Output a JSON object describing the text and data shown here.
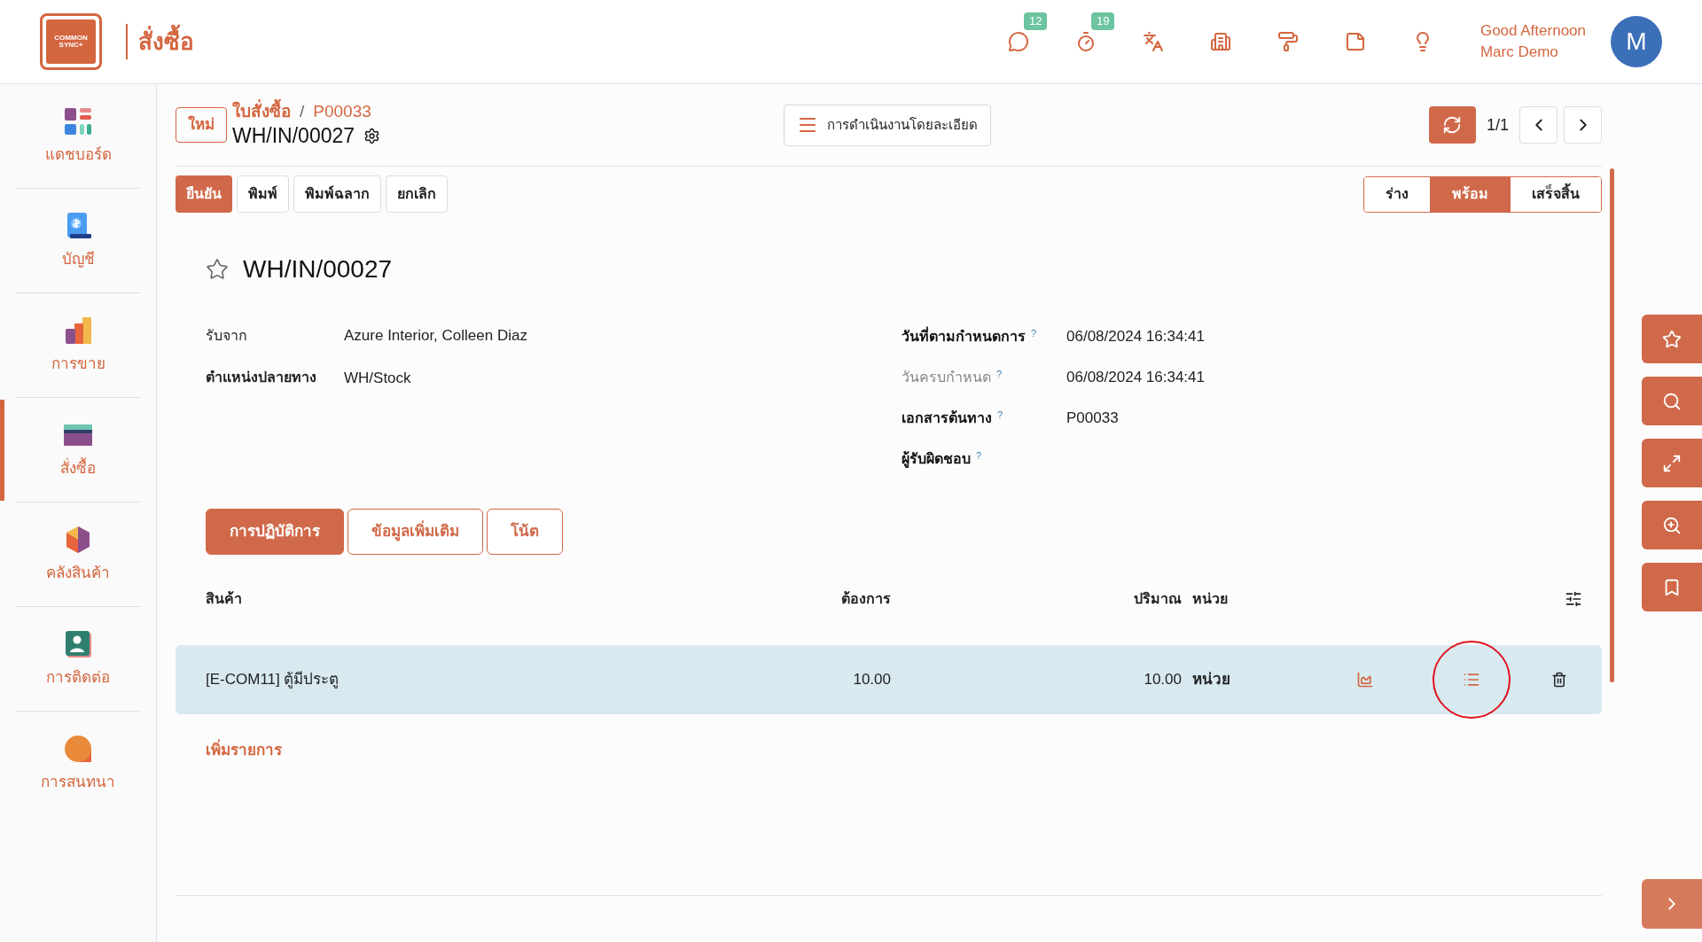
{
  "logo": {
    "lines": [
      "COMMON",
      "SYNC+"
    ]
  },
  "app": {
    "title": "สั่งซื้อ"
  },
  "topbar": {
    "icons": [
      {
        "kind": "chat",
        "badge": "12"
      },
      {
        "kind": "timer",
        "badge": "19"
      },
      {
        "kind": "translate"
      },
      {
        "kind": "company"
      },
      {
        "kind": "paint"
      },
      {
        "kind": "note"
      },
      {
        "kind": "bulb"
      }
    ],
    "greeting": "Good Afternoon",
    "user": "Marc Demo",
    "avatar": "M"
  },
  "sidebar": {
    "items": [
      {
        "kind": "dashboard",
        "label": "แดชบอร์ด",
        "selected": false
      },
      {
        "kind": "accounting",
        "label": "บัญชี",
        "selected": false
      },
      {
        "kind": "sales",
        "label": "การขาย",
        "selected": false
      },
      {
        "kind": "purchase",
        "label": "สั่งซื้อ",
        "selected": true
      },
      {
        "kind": "inventory",
        "label": "คลังสินค้า",
        "selected": false
      },
      {
        "kind": "contacts",
        "label": "การติดต่อ",
        "selected": false
      },
      {
        "kind": "discuss",
        "label": "การสนทนา",
        "selected": false
      }
    ]
  },
  "breadcrumb": {
    "new_button": "ใหม่",
    "parent": "ใบสั่งซื้อ",
    "separator": "/",
    "source": "P00033",
    "record": "WH/IN/00027"
  },
  "actions_menu": "การดำเนินงานโดยละเอียด",
  "pager": "1/1",
  "buttons": [
    {
      "label": "ยืนยัน",
      "primary": true
    },
    {
      "label": "พิมพ์",
      "primary": false
    },
    {
      "label": "พิมพ์ฉลาก",
      "primary": false
    },
    {
      "label": "ยกเลิก",
      "primary": false
    }
  ],
  "status": [
    {
      "label": "ร่าง",
      "selected": false
    },
    {
      "label": "พร้อม",
      "selected": true
    },
    {
      "label": "เสร็จสิ้น",
      "selected": false
    }
  ],
  "record": {
    "title": "WH/IN/00027",
    "starred": false
  },
  "fields_left": [
    {
      "label": "รับจาก",
      "value": "Azure Interior, Colleen Diaz",
      "bold": false
    },
    {
      "label": "ตำแหน่งปลายทาง",
      "value": "WH/Stock",
      "bold": true
    }
  ],
  "fields_right": [
    {
      "label": "วันที่ตามกำหนดการ",
      "help": "?",
      "value": "06/08/2024 16:34:41",
      "muted": false
    },
    {
      "label": "วันครบกำหนด",
      "help": "?",
      "value": "06/08/2024 16:34:41",
      "muted": true
    },
    {
      "label": "เอกสารต้นทาง",
      "help": "?",
      "value": "P00033",
      "muted": false
    },
    {
      "label": "ผู้รับผิดชอบ",
      "help": "?",
      "muted": false
    }
  ],
  "tabs": [
    {
      "label": "การปฏิบัติการ",
      "selected": true
    },
    {
      "label": "ข้อมูลเพิ่มเติม",
      "selected": false
    },
    {
      "label": "โน้ต",
      "selected": false
    }
  ],
  "table": {
    "columns": [
      "สินค้า",
      "ต้องการ",
      "ปริมาณ",
      "หน่วย"
    ],
    "rows": [
      {
        "product": "[E-COM11] ตู้มีประตู",
        "demand": "10.00",
        "quantity": "10.00",
        "unit": "หน่วย",
        "selected": true,
        "circled": true
      }
    ],
    "add_line": "เพิ่มรายการ"
  },
  "side_tools": [
    {
      "kind": "star"
    },
    {
      "kind": "search"
    },
    {
      "kind": "expand"
    },
    {
      "kind": "zoom"
    },
    {
      "kind": "bookmark"
    }
  ],
  "side_toggle": {
    "kind": "next"
  }
}
